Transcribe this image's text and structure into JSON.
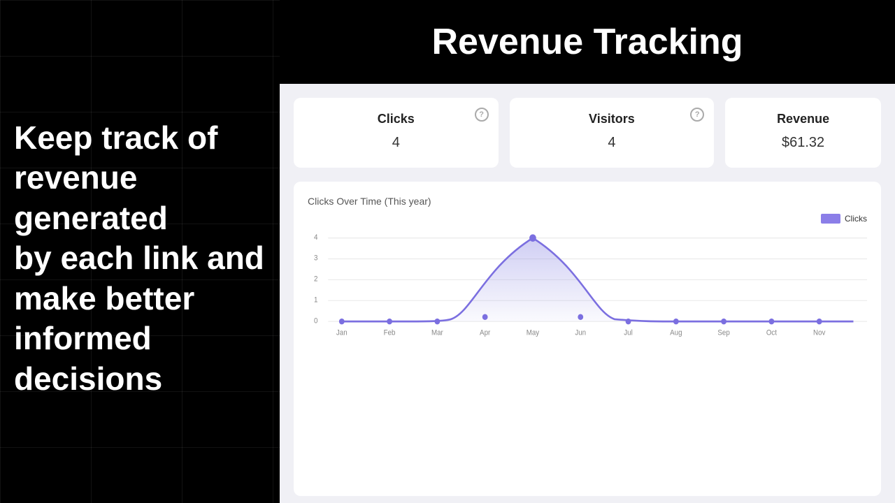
{
  "left": {
    "headline_lines": [
      "Keep track of",
      "revenue generated",
      "by each link and",
      "make better",
      "informed decisions"
    ]
  },
  "header": {
    "title": "Revenue Tracking"
  },
  "stats": [
    {
      "label": "Clicks",
      "value": "4"
    },
    {
      "label": "Visitors",
      "value": "4"
    },
    {
      "label": "Revenue",
      "value": "$61.32"
    }
  ],
  "chart": {
    "title": "Clicks Over Time (This year)",
    "legend_label": "Clicks",
    "y_axis": [
      4,
      3,
      2,
      1,
      0
    ],
    "x_axis": [
      "Jan",
      "Feb",
      "Mar",
      "Apr",
      "May",
      "Jun",
      "Jul",
      "Aug",
      "Sep",
      "Oct",
      "Nov"
    ],
    "data_points": [
      0,
      0,
      0,
      0.2,
      4,
      0.2,
      0,
      0,
      0,
      0,
      0
    ]
  },
  "icons": {
    "help": "?"
  }
}
